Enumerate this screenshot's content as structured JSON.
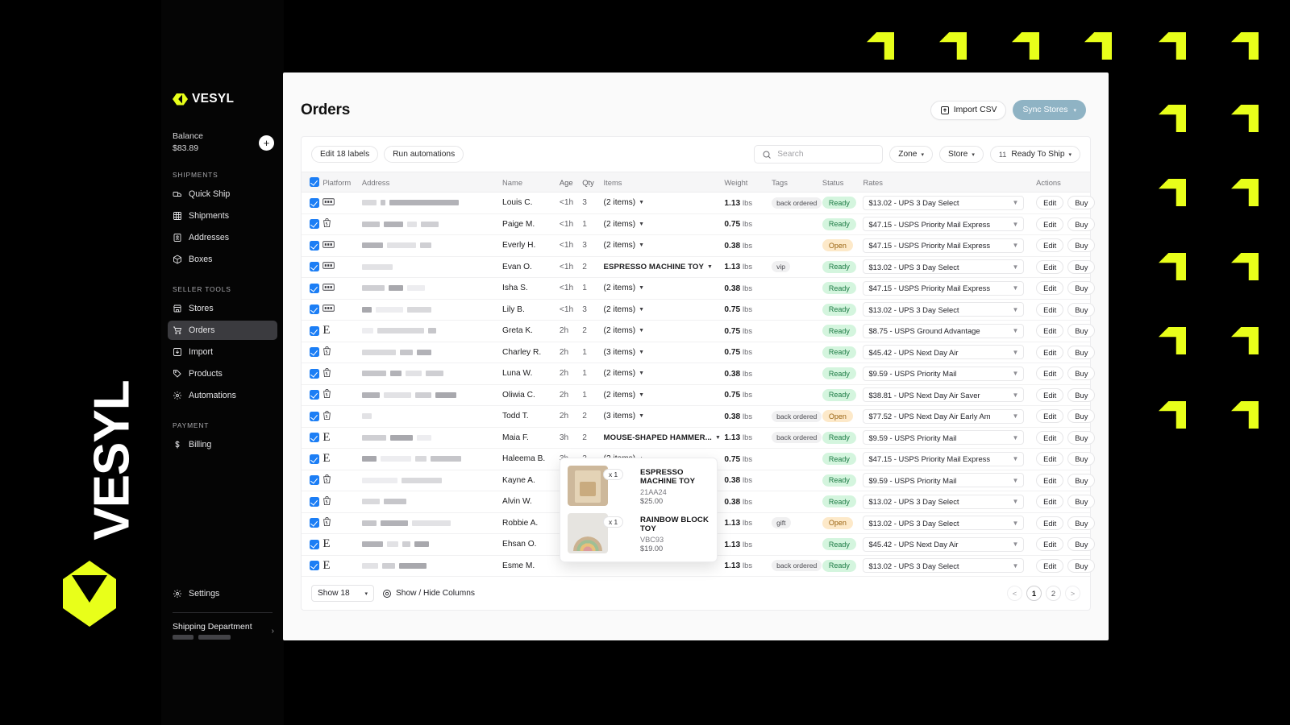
{
  "brand": {
    "name": "VESYL",
    "accent": "#e8ff1a",
    "watermark": "VESYL"
  },
  "sidebar": {
    "balance_label": "Balance",
    "balance_amount": "$83.89",
    "add_funds_label": "+",
    "groups": [
      {
        "title": "SHIPMENTS",
        "items": [
          {
            "label": "Quick Ship",
            "icon": "truck-icon",
            "active": false
          },
          {
            "label": "Shipments",
            "icon": "grid-icon",
            "active": false
          },
          {
            "label": "Addresses",
            "icon": "address-book-icon",
            "active": false
          },
          {
            "label": "Boxes",
            "icon": "box-icon",
            "active": false
          }
        ]
      },
      {
        "title": "SELLER TOOLS",
        "items": [
          {
            "label": "Stores",
            "icon": "store-icon",
            "active": false
          },
          {
            "label": "Orders",
            "icon": "cart-icon",
            "active": true
          },
          {
            "label": "Import",
            "icon": "download-icon",
            "active": false
          },
          {
            "label": "Products",
            "icon": "tag-icon",
            "active": false
          },
          {
            "label": "Automations",
            "icon": "gear-icon",
            "active": false
          }
        ]
      },
      {
        "title": "PAYMENT",
        "items": [
          {
            "label": "Billing",
            "icon": "dollar-icon",
            "active": false
          }
        ]
      }
    ],
    "settings_label": "Settings",
    "account_name": "Shipping Department"
  },
  "header": {
    "title": "Orders",
    "import_csv_label": "Import CSV",
    "sync_stores_label": "Sync Stores",
    "sync_stores_color": "#8fb3c4"
  },
  "toolbar": {
    "edit_labels_label": "Edit 18 labels",
    "run_automations_label": "Run automations",
    "search_placeholder": "Search",
    "search_value": "",
    "zone_label": "Zone",
    "store_label": "Store",
    "status_filter_count": "11",
    "status_filter_label": "Ready To Ship"
  },
  "table": {
    "columns": [
      "Platform",
      "Address",
      "Name",
      "Age",
      "Qty",
      "Items",
      "Weight",
      "Tags",
      "Status",
      "Rates",
      "Actions"
    ],
    "edit_label": "Edit",
    "buy_label": "Buy",
    "rows": [
      {
        "platform": "ebay",
        "name": "Louis C.",
        "age": "<1h",
        "qty": "3",
        "items": "(2 items)",
        "items_expanded": false,
        "weight": "1.13",
        "unit": "lbs",
        "tag": "back ordered",
        "status": "Ready",
        "rate": "$13.02 - UPS 3 Day Select",
        "addr_bars": [
          18,
          6,
          86
        ]
      },
      {
        "platform": "shopify",
        "name": "Paige M.",
        "age": "<1h",
        "qty": "1",
        "items": "(2 items)",
        "items_expanded": false,
        "weight": "0.75",
        "unit": "lbs",
        "tag": "",
        "status": "Ready",
        "rate": "$47.15 - USPS Priority Mail Express",
        "addr_bars": [
          22,
          24,
          12,
          22
        ]
      },
      {
        "platform": "ebay",
        "name": "Everly H.",
        "age": "<1h",
        "qty": "3",
        "items": "(2 items)",
        "items_expanded": false,
        "weight": "0.38",
        "unit": "lbs",
        "tag": "",
        "status": "Open",
        "rate": "$47.15 - USPS Priority Mail Express",
        "addr_bars": [
          26,
          36,
          14
        ]
      },
      {
        "platform": "ebay",
        "name": "Evan O.",
        "age": "<1h",
        "qty": "2",
        "items": "ESPRESSO MACHINE TOY",
        "items_expanded": false,
        "is_product": true,
        "weight": "1.13",
        "unit": "lbs",
        "tag": "vip",
        "status": "Ready",
        "rate": "$13.02 - UPS 3 Day Select",
        "addr_bars": [
          38
        ]
      },
      {
        "platform": "ebay",
        "name": "Isha S.",
        "age": "<1h",
        "qty": "1",
        "items": "(2 items)",
        "items_expanded": false,
        "weight": "0.38",
        "unit": "lbs",
        "tag": "",
        "status": "Ready",
        "rate": "$47.15 - USPS Priority Mail Express",
        "addr_bars": [
          28,
          18,
          22
        ]
      },
      {
        "platform": "ebay",
        "name": "Lily B.",
        "age": "<1h",
        "qty": "3",
        "items": "(2 items)",
        "items_expanded": false,
        "weight": "0.75",
        "unit": "lbs",
        "tag": "",
        "status": "Ready",
        "rate": "$13.02 - UPS 3 Day Select",
        "addr_bars": [
          12,
          34,
          30
        ]
      },
      {
        "platform": "etsy",
        "name": "Greta K.",
        "age": "2h",
        "qty": "2",
        "items": "(2 items)",
        "items_expanded": false,
        "weight": "0.75",
        "unit": "lbs",
        "tag": "",
        "status": "Ready",
        "rate": "$8.75 - USPS Ground Advantage",
        "addr_bars": [
          14,
          58,
          10
        ]
      },
      {
        "platform": "shopify",
        "name": "Charley R.",
        "age": "2h",
        "qty": "1",
        "items": "(3 items)",
        "items_expanded": false,
        "weight": "0.75",
        "unit": "lbs",
        "tag": "",
        "status": "Ready",
        "rate": "$45.42 - UPS Next Day Air",
        "addr_bars": [
          42,
          16,
          18
        ]
      },
      {
        "platform": "shopify",
        "name": "Luna W.",
        "age": "2h",
        "qty": "1",
        "items": "(2 items)",
        "items_expanded": false,
        "weight": "0.38",
        "unit": "lbs",
        "tag": "",
        "status": "Ready",
        "rate": "$9.59 - USPS Priority Mail",
        "addr_bars": [
          30,
          14,
          20,
          22
        ]
      },
      {
        "platform": "shopify",
        "name": "Oliwia C.",
        "age": "2h",
        "qty": "1",
        "items": "(2 items)",
        "items_expanded": false,
        "weight": "0.75",
        "unit": "lbs",
        "tag": "",
        "status": "Ready",
        "rate": "$38.81 - UPS Next Day Air Saver",
        "addr_bars": [
          22,
          34,
          20,
          26
        ]
      },
      {
        "platform": "shopify",
        "name": "Todd T.",
        "age": "2h",
        "qty": "2",
        "items": "(3 items)",
        "items_expanded": false,
        "weight": "0.38",
        "unit": "lbs",
        "tag": "back ordered",
        "status": "Open",
        "rate": "$77.52 - UPS Next Day Air Early Am",
        "addr_bars": [
          12
        ]
      },
      {
        "platform": "etsy",
        "name": "Maia F.",
        "age": "3h",
        "qty": "2",
        "items": "MOUSE-SHAPED HAMMER...",
        "items_expanded": false,
        "is_product": true,
        "weight": "1.13",
        "unit": "lbs",
        "tag": "back ordered",
        "status": "Ready",
        "rate": "$9.59 - USPS Priority Mail",
        "addr_bars": [
          30,
          28,
          18
        ]
      },
      {
        "platform": "etsy",
        "name": "Haleema B.",
        "age": "3h",
        "qty": "3",
        "items": "(2 items)",
        "items_expanded": true,
        "weight": "0.75",
        "unit": "lbs",
        "tag": "",
        "status": "Ready",
        "rate": "$47.15 - USPS Priority Mail Express",
        "addr_bars": [
          18,
          38,
          14,
          38
        ]
      },
      {
        "platform": "shopify",
        "name": "Kayne A.",
        "age": "",
        "qty": "",
        "items": "",
        "items_expanded": false,
        "weight": "0.38",
        "unit": "lbs",
        "tag": "",
        "status": "Ready",
        "rate": "$9.59 - USPS Priority Mail",
        "addr_bars": [
          44,
          50
        ]
      },
      {
        "platform": "shopify",
        "name": "Alvin W.",
        "age": "",
        "qty": "",
        "items": "",
        "items_expanded": false,
        "weight": "0.38",
        "unit": "lbs",
        "tag": "",
        "status": "Ready",
        "rate": "$13.02 - UPS 3 Day Select",
        "addr_bars": [
          22,
          28
        ]
      },
      {
        "platform": "shopify",
        "name": "Robbie A.",
        "age": "",
        "qty": "",
        "items": "",
        "items_expanded": false,
        "weight": "1.13",
        "unit": "lbs",
        "tag": "gift",
        "status": "Open",
        "rate": "$13.02 - UPS 3 Day Select",
        "addr_bars": [
          18,
          34,
          48
        ]
      },
      {
        "platform": "etsy",
        "name": "Ehsan O.",
        "age": "",
        "qty": "",
        "items": "",
        "items_expanded": false,
        "weight": "1.13",
        "unit": "lbs",
        "tag": "",
        "status": "Ready",
        "rate": "$45.42 - UPS Next Day Air",
        "addr_bars": [
          26,
          14,
          10,
          18
        ]
      },
      {
        "platform": "etsy",
        "name": "Esme M.",
        "age": "",
        "qty": "",
        "items": "",
        "items_expanded": false,
        "weight": "1.13",
        "unit": "lbs",
        "tag": "back ordered",
        "status": "Ready",
        "rate": "$13.02 - UPS 3 Day Select",
        "addr_bars": [
          20,
          16,
          34
        ]
      }
    ]
  },
  "footer": {
    "show_count_label": "Show 18",
    "show_hide_columns_label": "Show / Hide Columns",
    "pager": {
      "prev": "<",
      "pages": [
        "1",
        "2"
      ],
      "current": "1",
      "next": ">"
    }
  },
  "popover": {
    "items": [
      {
        "qty": "x 1",
        "title": "ESPRESSO MACHINE TOY",
        "sku": "21AA24",
        "price": "$25.00",
        "thumb": "espresso"
      },
      {
        "qty": "x 1",
        "title": "RAINBOW BLOCK TOY",
        "sku": "VBC93",
        "price": "$19.00",
        "thumb": "rainbow"
      }
    ]
  }
}
